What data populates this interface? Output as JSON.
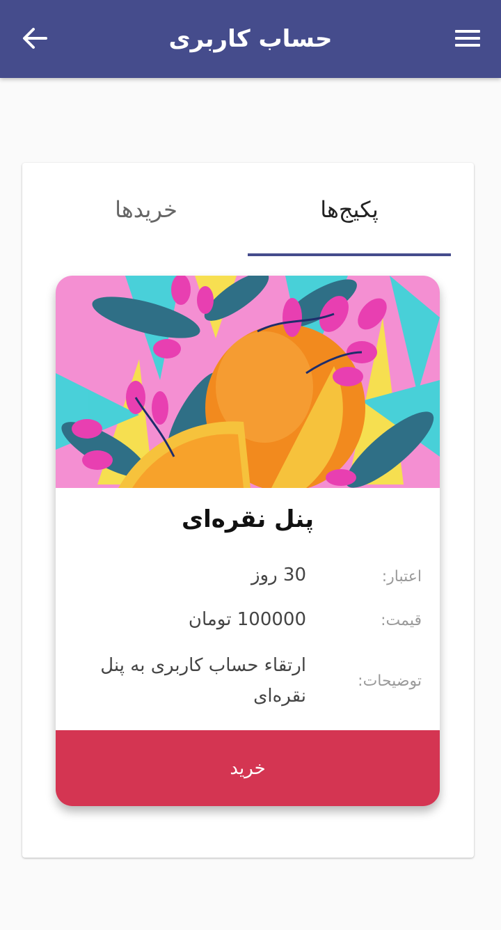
{
  "appbar": {
    "title": "حساب کاربری",
    "color": "#454c8c",
    "back_icon": "arrow-left-icon",
    "menu_icon": "hamburger-menu-icon"
  },
  "tabs": [
    {
      "label": "پکیج‌ها",
      "active": true
    },
    {
      "label": "خریدها",
      "active": false
    }
  ],
  "package": {
    "image_subject": "illustration of oranges with pink flowers and teal leaves",
    "title": "پنل نقره‌ای",
    "validity_label": "اعتبار:",
    "validity_value": "30 روز",
    "price_label": "قیمت:",
    "price_value": "100000 تومان",
    "description_label": "توضیحات:",
    "description_value": "ارتقاء حساب کاربری به پنل نقره‌ای",
    "buy_label": "خرید",
    "buy_color": "#d43552"
  }
}
